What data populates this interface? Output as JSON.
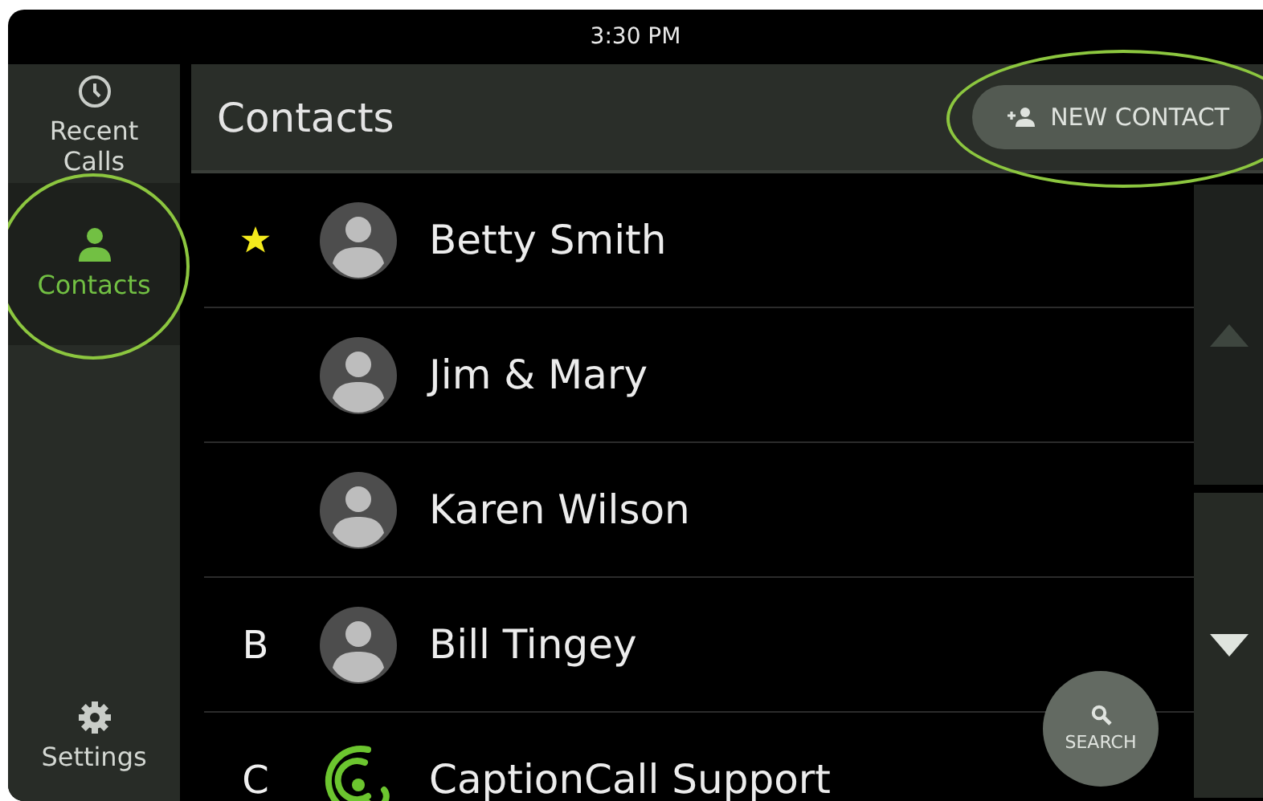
{
  "status_bar": {
    "time": "3:30 PM"
  },
  "nav": [
    {
      "label": "Recent Calls",
      "selected": false,
      "highlighted": false
    },
    {
      "label": "Contacts",
      "selected": true,
      "highlighted": true
    },
    {
      "label": "Settings",
      "selected": false,
      "highlighted": false
    }
  ],
  "header": {
    "title": "Contacts",
    "new_button": {
      "label": "NEW CONTACT",
      "highlighted": true
    }
  },
  "contacts": [
    {
      "name": "Betty Smith",
      "favorite": true,
      "kind": "person"
    },
    {
      "name": "Jim & Mary",
      "favorite": false,
      "kind": "person"
    },
    {
      "name": "Karen Wilson",
      "favorite": false,
      "kind": "person"
    },
    {
      "name": "Bill Tingey",
      "section": "B",
      "favorite": false,
      "kind": "person"
    },
    {
      "name": "CaptionCall Support",
      "section": "C",
      "favorite": false,
      "kind": "brand"
    }
  ],
  "search_button": {
    "label": "SEARCH"
  }
}
